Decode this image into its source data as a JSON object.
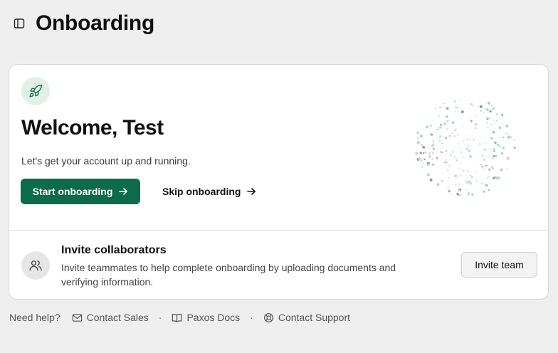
{
  "header": {
    "title": "Onboarding",
    "sidebar_toggle_icon": "sidebar-panel-icon"
  },
  "welcome": {
    "icon": "rocket-icon",
    "heading": "Welcome, Test",
    "subtitle": "Let's get your account up and running.",
    "primary_button": "Start onboarding",
    "secondary_link": "Skip onboarding"
  },
  "invite": {
    "icon": "users-icon",
    "title": "Invite collaborators",
    "description": "Invite teammates to help complete onboarding by uploading documents and verifying information.",
    "button": "Invite team"
  },
  "footer": {
    "help_text": "Need help?",
    "links": [
      {
        "label": "Contact Sales",
        "icon": "mail-icon"
      },
      {
        "label": "Paxos Docs",
        "icon": "book-icon"
      },
      {
        "label": "Contact Support",
        "icon": "lifebuoy-icon"
      }
    ],
    "separator": "·"
  },
  "colors": {
    "accent": "#0b6b4b",
    "rocket_badge_bg": "#e3efe9",
    "background": "#efefef",
    "card": "#ffffff"
  }
}
